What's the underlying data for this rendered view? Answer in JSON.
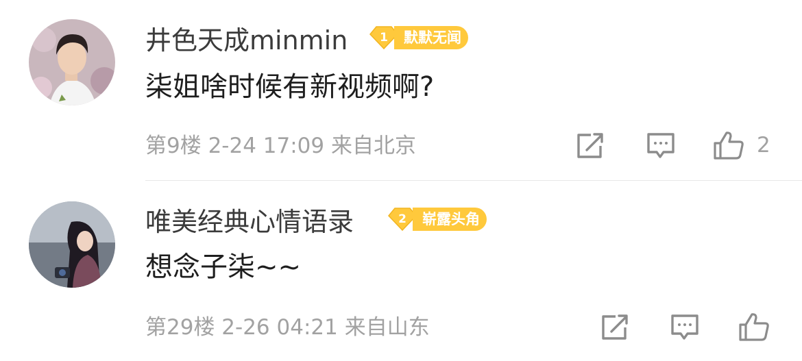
{
  "comments": [
    {
      "username": "井色天成minmin",
      "badge": {
        "level": "1",
        "label": "默默无闻"
      },
      "text": "柒姐啥时候有新视频啊?",
      "meta": "第9楼 2-24 17:09 来自北京",
      "likes": "2"
    },
    {
      "username": "唯美经典心情语录",
      "badge": {
        "level": "2",
        "label": "崭露头角"
      },
      "text": "想念子柒~~",
      "meta": "第29楼 2-26 04:21 来自山东",
      "likes": ""
    }
  ],
  "icons": {
    "share": "share-icon",
    "reply": "comment-icon",
    "like": "thumbs-up-icon"
  },
  "colors": {
    "badge": "#ffc93c",
    "meta": "#a2a2a2",
    "username": "#3b3b3b"
  }
}
